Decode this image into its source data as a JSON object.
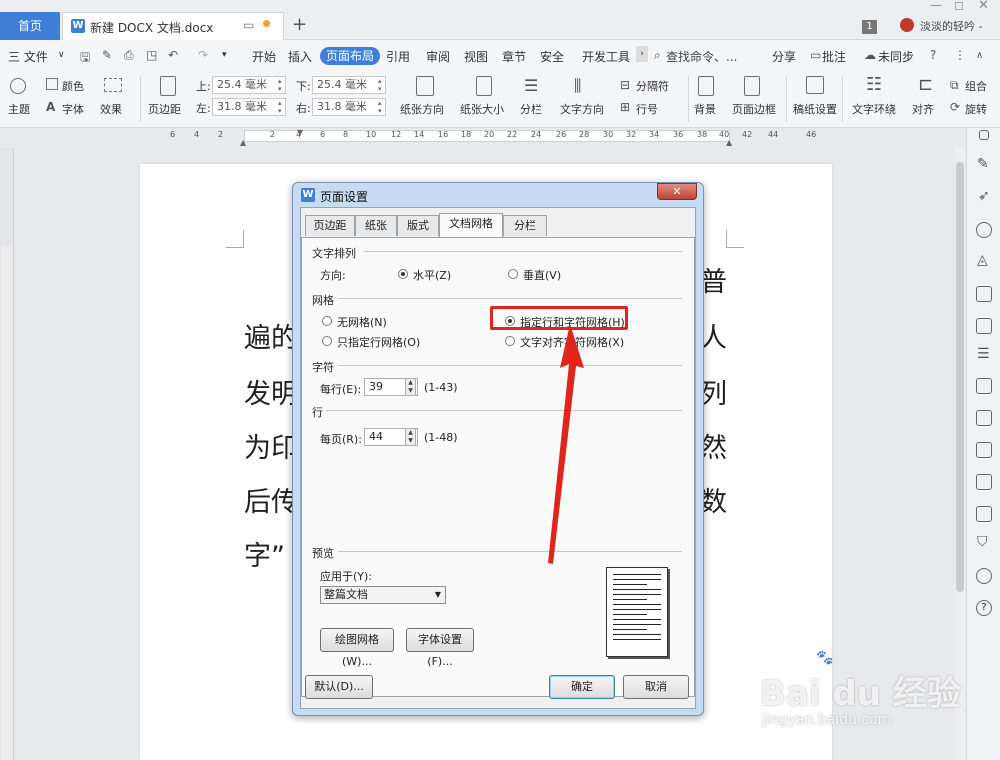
{
  "tabs": {
    "home": "首页",
    "doc": "新建 DOCX 文档.docx",
    "badge": "1",
    "user": "淡淡的轻吟 -"
  },
  "menu": {
    "file": "三 文件",
    "items": [
      "开始",
      "插入",
      "页面布局",
      "引用",
      "审阅",
      "视图",
      "章节",
      "安全",
      "开发工具"
    ],
    "active": "页面布局",
    "search": "查找命令、...",
    "share": "分享",
    "comment": "批注",
    "sync": "未同步"
  },
  "ribbon": {
    "theme": "主题",
    "color": "颜色",
    "font": "字体",
    "effect": "效果",
    "margin": "页边距",
    "top_label": "上:",
    "top_value": "25.4 毫米",
    "bottom_label": "下:",
    "bottom_value": "25.4 毫米",
    "left_label": "左:",
    "left_value": "31.8 毫米",
    "right_label": "右:",
    "right_value": "31.8 毫米",
    "orientation": "纸张方向",
    "size": "纸张大小",
    "columns": "分栏",
    "text_dir": "文字方向",
    "separator": "分隔符",
    "line_num": "行号",
    "background": "背景",
    "page_border": "页面边框",
    "manuscript": "稿纸设置",
    "wrap": "文字环绕",
    "align": "对齐",
    "group": "组合",
    "rotate": "旋转"
  },
  "ruler": [
    "6",
    "4",
    "2",
    "2",
    "4",
    "6",
    "8",
    "10",
    "12",
    "14",
    "16",
    "18",
    "20",
    "22",
    "24",
    "26",
    "28",
    "30",
    "32",
    "34",
    "36",
    "38",
    "40",
    "42",
    "44",
    "46"
  ],
  "page_text": {
    "r1": "普",
    "r2l": "遍的",
    "r2r": "人",
    "r3l": "发明",
    "r3r": "列",
    "r4l": "为印",
    "r4r": "然",
    "r5l": "后传",
    "r5r": "数",
    "r6l": "字”"
  },
  "dialog": {
    "title": "页面设置",
    "tabs": [
      "页边距",
      "纸张",
      "版式",
      "文档网格",
      "分栏"
    ],
    "selected_tab": "文档网格",
    "text_arrangement": "文字排列",
    "direction_label": "方向:",
    "horizontal": "水平(Z)",
    "vertical": "垂直(V)",
    "grid": "网格",
    "no_grid": "无网格(N)",
    "line_grid_only": "只指定行网格(O)",
    "line_char_grid": "指定行和字符网格(H)",
    "text_snap_grid": "文字对齐字符网格(X)",
    "chars": "字符",
    "per_line_label": "每行(E):",
    "per_line_value": "39",
    "per_line_range": "(1-43)",
    "lines": "行",
    "per_page_label": "每页(R):",
    "per_page_value": "44",
    "per_page_range": "(1-48)",
    "preview": "预览",
    "apply_to_label": "应用于(Y):",
    "apply_to_value": "整篇文档",
    "draw_grid": "绘图网格(W)...",
    "font_settings": "字体设置(F)...",
    "default": "默认(D)...",
    "ok": "确定",
    "cancel": "取消"
  },
  "watermark": {
    "brand": "Bai du 经验",
    "url": "jingyan.baidu.com"
  },
  "colors": {
    "accent": "#3f7fd8",
    "highlight": "#e0261c"
  }
}
